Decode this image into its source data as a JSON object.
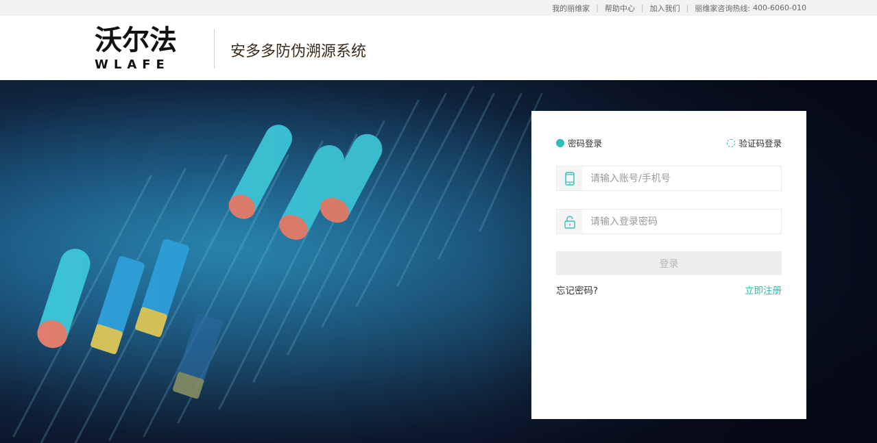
{
  "topbar": {
    "links": [
      "我的丽维家",
      "帮助中心",
      "加入我们"
    ],
    "hotline_label": "丽维家咨询热线:",
    "hotline_number": "400-6060-010"
  },
  "header": {
    "logo_cn": "沃尔法",
    "logo_en": "WLAFE",
    "system_title": "安多多防伪溯源系统"
  },
  "login": {
    "tab_password": "密码登录",
    "tab_sms": "验证码登录",
    "username_placeholder": "请输入账号/手机号",
    "password_placeholder": "请输入登录密码",
    "submit_label": "登录",
    "forgot_label": "忘记密码?",
    "register_label": "立即注册"
  },
  "icons": {
    "tab_active": "radio-checked-icon",
    "tab_inactive": "radio-unchecked-icon",
    "username": "mobile-phone-icon",
    "password": "padlock-icon"
  },
  "colors": {
    "accent": "#2ebfb4",
    "title_text": "#3a2a1c",
    "banner_dark": "#0b1226",
    "banner_blue": "#1f6f9a",
    "capsule_cyan": "#3cc3d6",
    "capsule_salmon": "#e07e6e",
    "capsule_yellow": "#d7c35a"
  }
}
